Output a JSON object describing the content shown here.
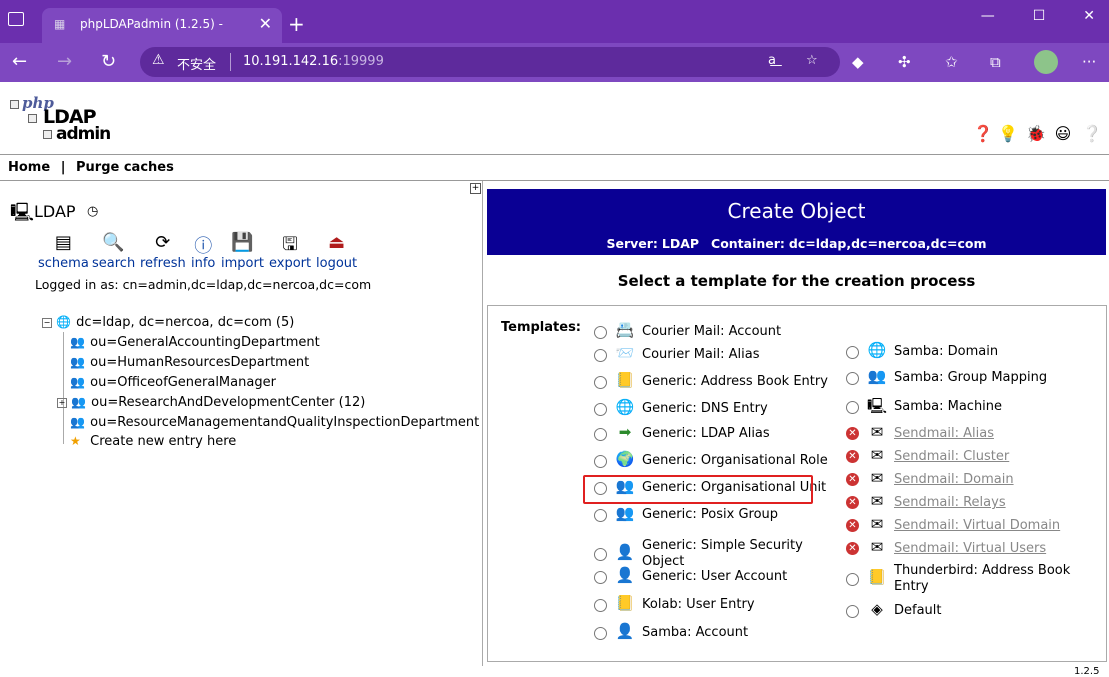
{
  "browser": {
    "tab_title": "phpLDAPadmin (1.2.5) -",
    "insecure_label": "不安全",
    "url_host": "10.191.142.16",
    "url_port": ":19999"
  },
  "menu": {
    "home": "Home",
    "separator": "|",
    "purge": "Purge caches"
  },
  "logo": {
    "php": "php",
    "ldap": "LDAP",
    "admin": "admin"
  },
  "server": {
    "name": "LDAP",
    "tools": [
      {
        "label": "schema",
        "icon": "schema-icon"
      },
      {
        "label": "search",
        "icon": "search-icon"
      },
      {
        "label": "refresh",
        "icon": "refresh-icon"
      },
      {
        "label": "info",
        "icon": "info-icon"
      },
      {
        "label": "import",
        "icon": "import-icon"
      },
      {
        "label": "export",
        "icon": "export-icon"
      },
      {
        "label": "logout",
        "icon": "logout-icon"
      }
    ],
    "logged_in": "Logged in as: cn=admin,dc=ldap,dc=nercoa,dc=com"
  },
  "tree": {
    "root": "dc=ldap, dc=nercoa, dc=com (5)",
    "children": [
      "ou=GeneralAccountingDepartment",
      "ou=HumanResourcesDepartment",
      "ou=OfficeofGeneralManager",
      "ou=ResearchAndDevelopmentCenter (12)",
      "ou=ResourceManagementandQualityInspectionDepartment"
    ],
    "create_new": "Create new entry here"
  },
  "create": {
    "title": "Create Object",
    "server_label": "Server:",
    "server_value": "LDAP",
    "container_label": "Container:",
    "container_value": "dc=ldap,dc=nercoa,dc=com",
    "subtitle": "Select a template for the creation process",
    "templates_label": "Templates:"
  },
  "templates_left": [
    "Courier Mail: Account",
    "Courier Mail: Alias",
    "Generic: Address Book Entry",
    "Generic: DNS Entry",
    "Generic: LDAP Alias",
    "Generic: Organisational Role",
    "Generic: Organisational Unit",
    "Generic: Posix Group",
    "Generic: Simple Security",
    "Object",
    "Generic: User Account",
    "Kolab: User Entry",
    "Samba: Account"
  ],
  "templates_right": [
    "Samba: Domain",
    "Samba: Group Mapping",
    "Samba: Machine",
    "Sendmail: Alias",
    "Sendmail: Cluster",
    "Sendmail: Domain",
    "Sendmail: Relays",
    "Sendmail: Virtual Domain",
    "Sendmail: Virtual Users",
    "Thunderbird: Address Book",
    "Entry",
    "Default"
  ],
  "footer": {
    "version": "1.2.5"
  },
  "colors": {
    "title_bg": "#0a0094",
    "browser": "#7e48c0",
    "highlight": "#e02020",
    "link": "#003399"
  }
}
